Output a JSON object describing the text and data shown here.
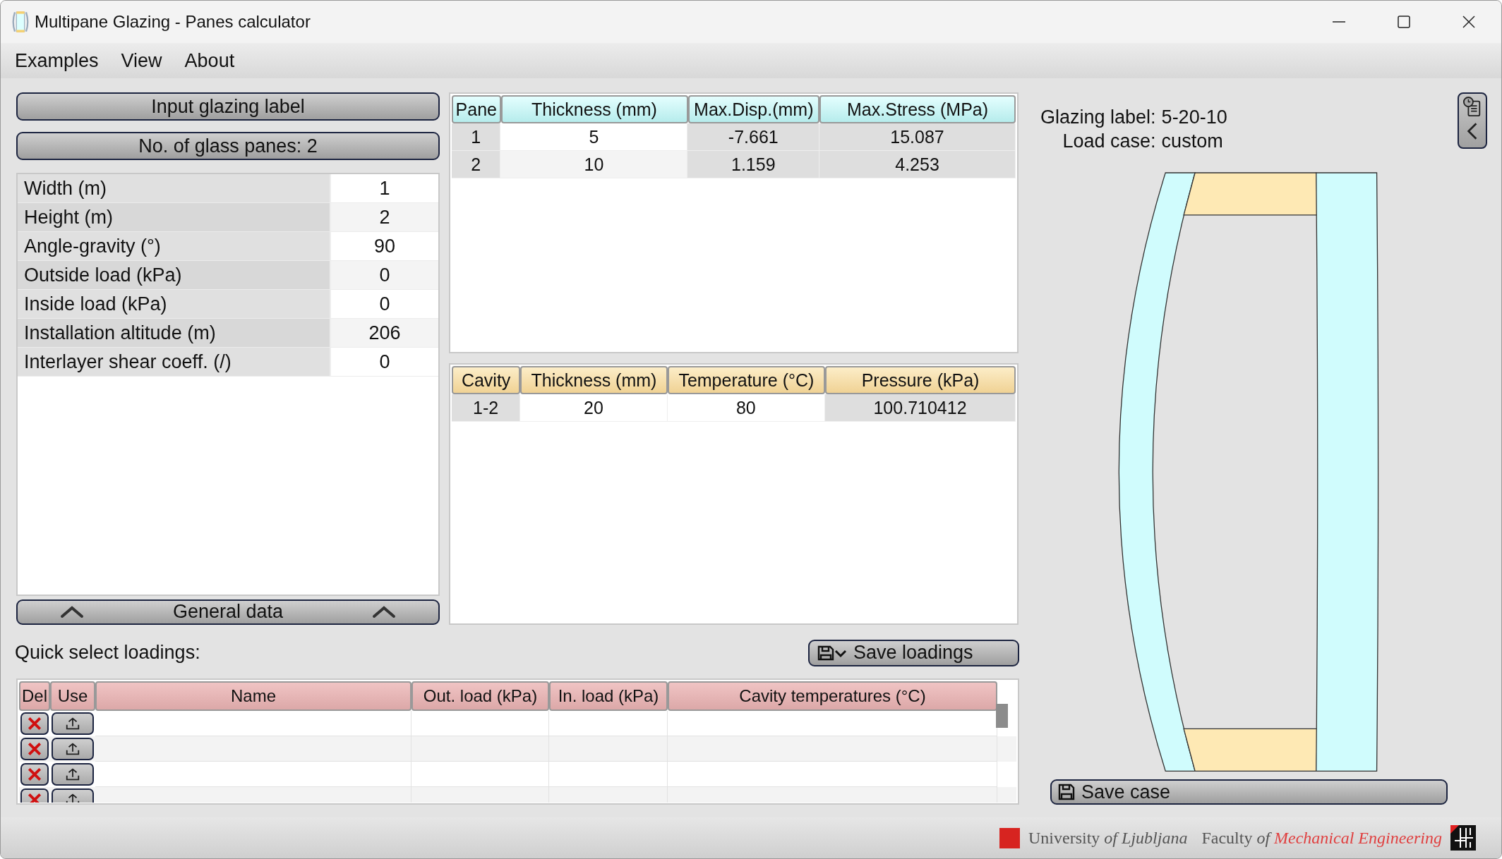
{
  "window": {
    "title": "Multipane Glazing - Panes calculator"
  },
  "menu": [
    "Examples",
    "View",
    "About"
  ],
  "left_panel": {
    "glazing_label_button": "Input glazing label",
    "panes_button": "No. of glass panes: 2",
    "parameters": [
      {
        "label": "Width (m)",
        "value": "1"
      },
      {
        "label": "Height (m)",
        "value": "2"
      },
      {
        "label": "Angle-gravity (°)",
        "value": "90"
      },
      {
        "label": "Outside load (kPa)",
        "value": "0"
      },
      {
        "label": "Inside load (kPa)",
        "value": "0"
      },
      {
        "label": "Installation altitude (m)",
        "value": "206"
      },
      {
        "label": "Interlayer shear coeff. (/)",
        "value": "0"
      }
    ],
    "general_data_button": "General data"
  },
  "panes_table": {
    "columns": [
      "Pane",
      "Thickness (mm)",
      "Max.Disp.(mm)",
      "Max.Stress (MPa)"
    ],
    "rows": [
      [
        "1",
        "5",
        "-7.661",
        "15.087"
      ],
      [
        "2",
        "10",
        "1.159",
        "4.253"
      ]
    ]
  },
  "cavities_table": {
    "columns": [
      "Cavity",
      "Thickness (mm)",
      "Temperature (°C)",
      "Pressure (kPa)"
    ],
    "rows": [
      [
        "1-2",
        "20",
        "80",
        "100.710412"
      ]
    ]
  },
  "loadings": {
    "title": "Quick select loadings:",
    "save_button": "Save loadings",
    "columns": [
      "Del",
      "Use",
      "Name",
      "Out. load (kPa)",
      "In. load (kPa)",
      "Cavity temperatures (°C)"
    ],
    "rows": [
      {
        "kind": "blank"
      },
      {
        "kind": "blank"
      },
      {
        "kind": "blank"
      },
      {
        "kind": "blank"
      }
    ]
  },
  "summary": [
    {
      "label": "Glazing label:",
      "value": "5-20-10"
    },
    {
      "label": "Load case:",
      "value": "custom"
    }
  ],
  "save_case_button": "Save case",
  "footer": {
    "university": "University *of Ljubljana*",
    "faculty": "Faculty *of*",
    "faculty_field": "Mechanical Engineering"
  }
}
